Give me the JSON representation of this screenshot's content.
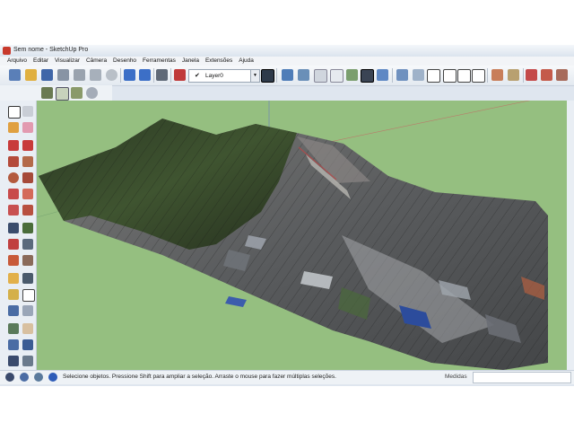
{
  "window": {
    "title": "Sem nome - SketchUp Pro"
  },
  "menu": {
    "items": [
      "Arquivo",
      "Editar",
      "Visualizar",
      "Câmera",
      "Desenho",
      "Ferramentas",
      "Janela",
      "Extensões",
      "Ajuda"
    ]
  },
  "toolbar": {
    "layer_check": "✔",
    "layer_value": "Layer0"
  },
  "status": {
    "message": "Selecione objetos. Pressione Shift para ampliar a seleção. Arraste o mouse para fazer múltiplas seleções.",
    "measurements_label": "Medidas"
  },
  "colors": {
    "ground": "#95bf80",
    "sky": "#ffffff",
    "chrome": "#dfe6ef"
  }
}
